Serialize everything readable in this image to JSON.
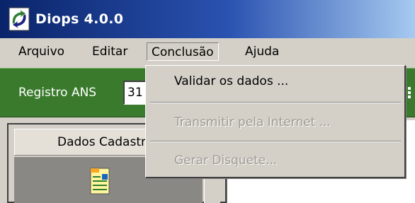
{
  "window": {
    "title": "Diops 4.0.0",
    "title_bar_color": "#0a246a",
    "icon": "diops-app-icon"
  },
  "menubar": {
    "items": [
      {
        "label": "Arquivo"
      },
      {
        "label": "Editar"
      },
      {
        "label": "Conclusão",
        "open": true
      },
      {
        "label": "Ajuda"
      }
    ]
  },
  "dropdown": {
    "items": [
      {
        "label": "Validar os dados ...",
        "enabled": true
      },
      {
        "label": "Transmitir pela Internet ...",
        "enabled": false
      },
      {
        "label": "Gerar Disquete...",
        "enabled": false
      }
    ]
  },
  "toolbar": {
    "background_color": "#3a7a2c",
    "registro_label": "Registro ANS",
    "registro_value": "31"
  },
  "panel": {
    "header": "Dados Cadastrais",
    "icon": "document-icon"
  }
}
